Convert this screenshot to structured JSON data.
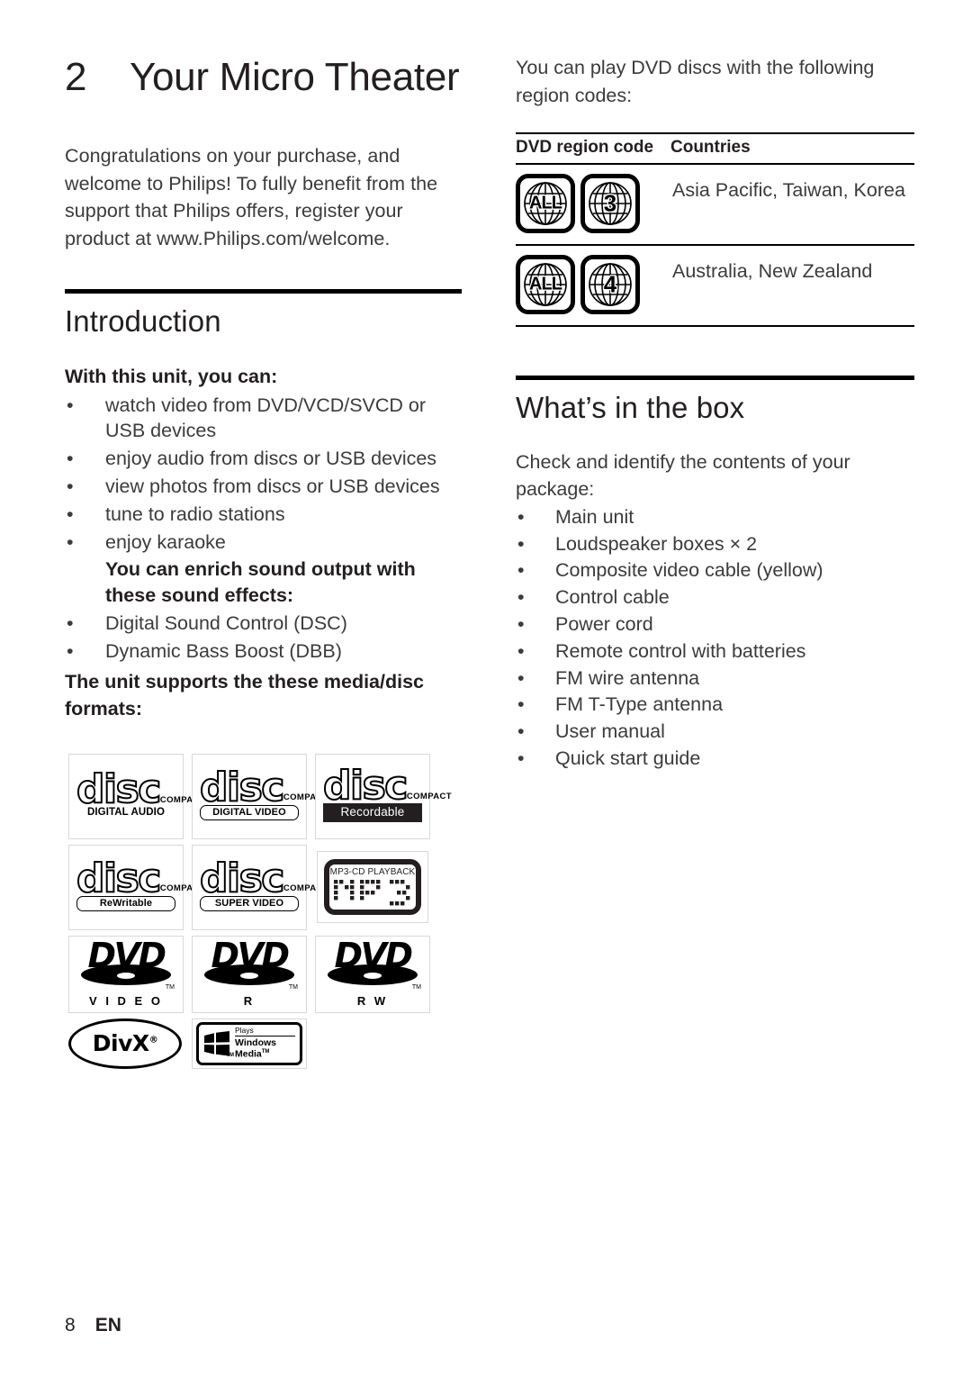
{
  "chapter": {
    "number": "2",
    "title": "Your Micro Theater"
  },
  "intro_paragraph": "Congratulations on your purchase, and welcome to Philips! To fully benefit from the support that Philips offers, register your product at www.Philips.com/welcome.",
  "introduction": {
    "heading": "Introduction",
    "lead": "With this unit, you can:",
    "features": [
      "watch video from DVD/VCD/SVCD or USB devices",
      "enjoy audio from discs or USB devices",
      "view photos from discs or USB devices",
      "tune to radio stations",
      "enjoy karaoke"
    ],
    "sound_lead": "You can enrich sound output with these sound effects:",
    "sound_effects": [
      "Digital Sound Control (DSC)",
      "Dynamic Bass Boost (DBB)"
    ],
    "formats_lead": "The unit supports the these media/disc formats:"
  },
  "logos": [
    [
      {
        "kind": "cd",
        "top": "COMPACT",
        "mid": "disc",
        "sub": "DIGITAL AUDIO",
        "style": "plain",
        "name": "compact-disc-digital-audio-logo"
      },
      {
        "kind": "cd",
        "top": "COMPACT",
        "mid": "disc",
        "sub": "DIGITAL VIDEO",
        "style": "boxed",
        "name": "compact-disc-digital-video-logo"
      },
      {
        "kind": "cd",
        "top": "COMPACT",
        "mid": "disc",
        "sub": "Recordable",
        "style": "inverted",
        "name": "compact-disc-recordable-logo"
      }
    ],
    [
      {
        "kind": "cd",
        "top": "COMPACT",
        "mid": "disc",
        "sub": "ReWritable",
        "style": "boxed",
        "name": "compact-disc-rewritable-logo"
      },
      {
        "kind": "cd",
        "top": "COMPACT",
        "mid": "disc",
        "sub": "SUPER VIDEO",
        "style": "boxed",
        "name": "compact-disc-super-video-logo"
      },
      {
        "kind": "mp3",
        "top": "MP3-CD PLAYBACK",
        "mid": "MP3",
        "name": "mp3-cd-playback-logo"
      }
    ],
    [
      {
        "kind": "dvd",
        "mid": "DVD",
        "sub": "V I D E O",
        "tm": "TM",
        "name": "dvd-video-logo"
      },
      {
        "kind": "dvd",
        "mid": "DVD",
        "sub": "R",
        "tm": "TM",
        "name": "dvd-r-logo"
      },
      {
        "kind": "dvd",
        "mid": "DVD",
        "sub": "R W",
        "tm": "TM",
        "name": "dvd-rw-logo"
      }
    ],
    [
      {
        "kind": "divx",
        "mid": "DivX",
        "reg": "®",
        "name": "divx-logo"
      },
      {
        "kind": "wm",
        "plays": "Plays",
        "line1": "Windows",
        "line2": "Media",
        "tm": "TM",
        "flag_tm": "TM",
        "name": "plays-windows-media-logo"
      }
    ]
  ],
  "region": {
    "intro": "You can play DVD discs with the following region codes:",
    "columns": [
      "DVD region code",
      "Countries"
    ],
    "rows": [
      {
        "badges": [
          "ALL",
          "3"
        ],
        "countries": "Asia Pacific, Taiwan, Korea"
      },
      {
        "badges": [
          "ALL",
          "4"
        ],
        "countries": "Australia, New Zealand"
      }
    ]
  },
  "box": {
    "heading": "What’s in the box",
    "lead": "Check and identify the contents of your package:",
    "items": [
      "Main unit",
      "Loudspeaker boxes × 2",
      "Composite video cable (yellow)",
      "Control cable",
      "Power cord",
      "Remote control with batteries",
      "FM wire antenna",
      "FM T-Type antenna",
      "User manual",
      "Quick start guide"
    ]
  },
  "footer": {
    "page_number": "8",
    "language": "EN"
  },
  "bullet_glyph": "•",
  "colors": {
    "text": "#3b3b3b",
    "heading": "#231f20",
    "rule": "#000000"
  }
}
